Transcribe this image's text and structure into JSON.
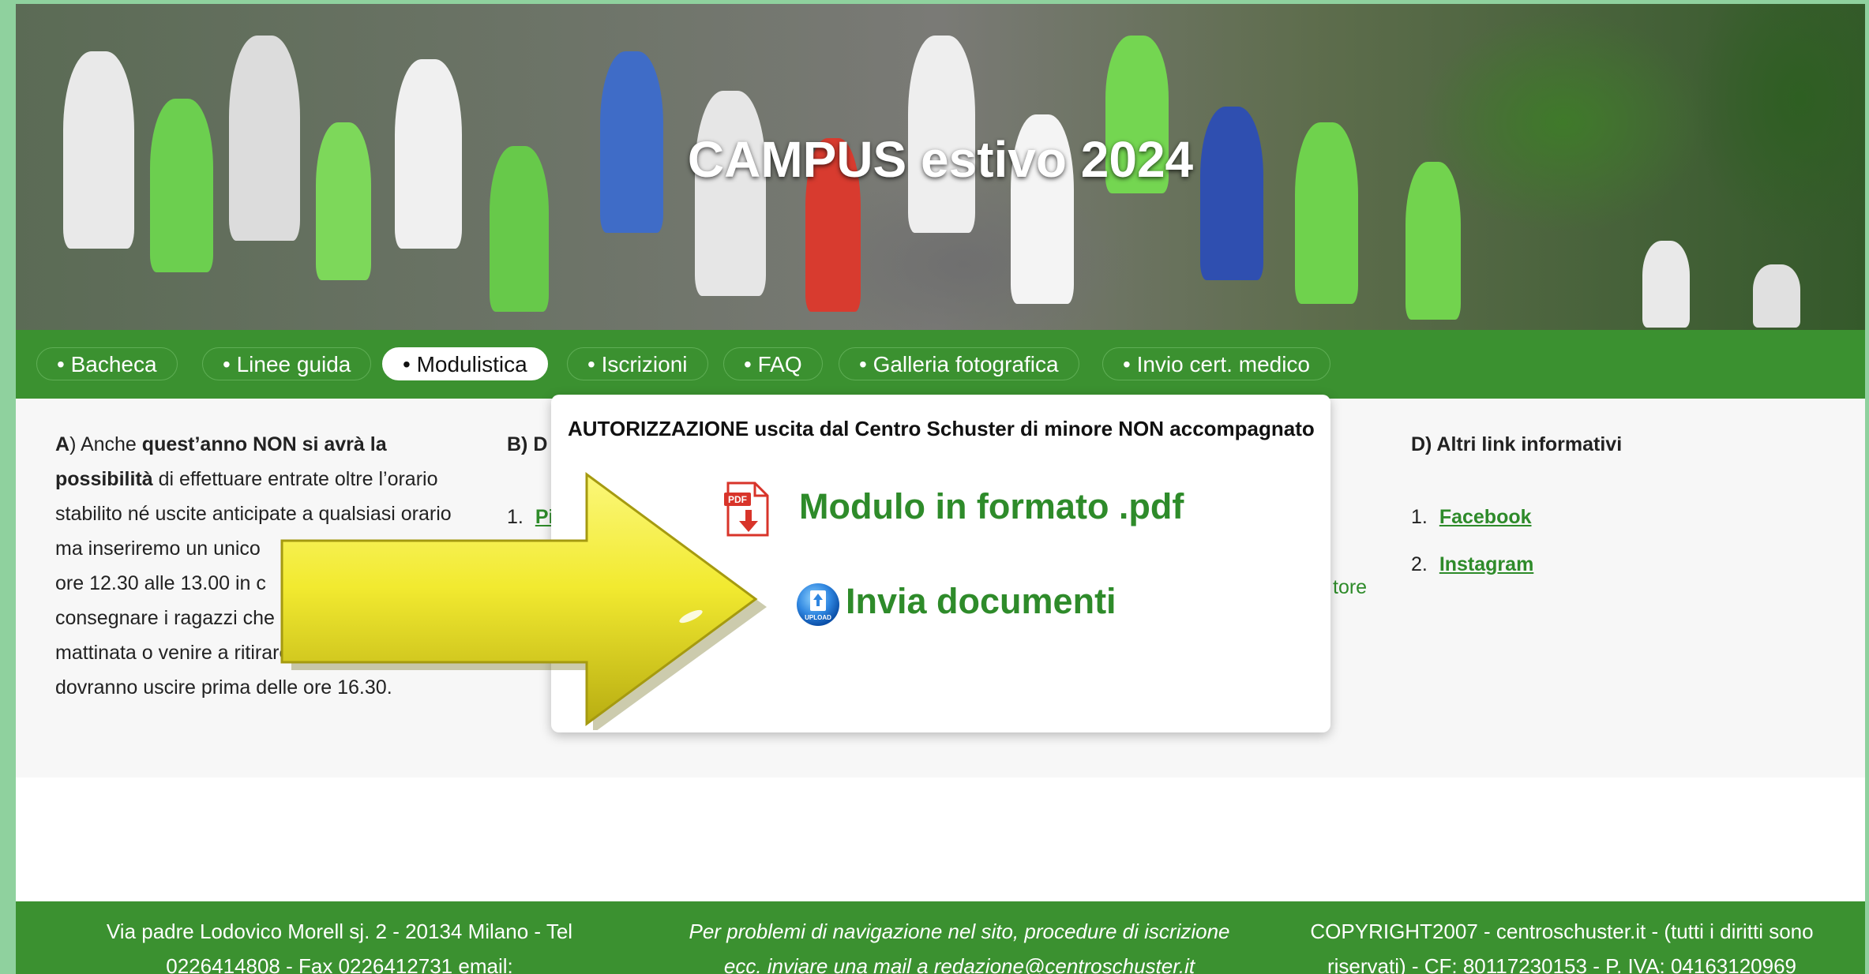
{
  "hero": {
    "title": "CAMPUS estivo 2024"
  },
  "nav": {
    "items": [
      {
        "label": "• Bacheca"
      },
      {
        "label": "• Linee guida"
      },
      {
        "label": "• Modulistica"
      },
      {
        "label": "• Iscrizioni"
      },
      {
        "label": "• FAQ"
      },
      {
        "label": "• Galleria fotografica"
      },
      {
        "label": "• Invio cert. medico"
      }
    ],
    "active_index": 2
  },
  "colA": {
    "prefix": "A",
    "t1": ") Anche ",
    "bold1": "quest’anno NON si avrà la",
    "bold2": "possibilità",
    "t2": " di effettuare entrate oltre l’orario",
    "lines": [
      "stabilito né uscite anticipate a qualsiasi orario",
      "ma inseriremo un unico",
      "ore 12.30 alle 13.00 in c",
      "consegnare i ragazzi che",
      "mattinata o venire a ritirare i ragazzi che",
      "dovranno uscire prima delle ore 16.30."
    ]
  },
  "colB": {
    "heading": "B) D",
    "num": "1.",
    "link": "Pi"
  },
  "colC": {
    "fragment": "tore"
  },
  "colD": {
    "heading": "D) Altri link informativi",
    "links": [
      {
        "num": "1.",
        "label": "Facebook"
      },
      {
        "num": "2.",
        "label": "Instagram"
      }
    ]
  },
  "popup": {
    "title": "AUTORIZZAZIONE uscita dal Centro Schuster di minore NON accompagnato",
    "pdf_link": "Modulo in formato .pdf",
    "pdf_icon_text": "PDF",
    "send_link": "Invia documenti",
    "upload_icon_text": "UPLOAD"
  },
  "footer": {
    "left1": "Via padre Lodovico Morell sj. 2 - 20134 Milano - Tel",
    "left2": "0226414808 - Fax 0226412731 email:",
    "mid1": "Per problemi di navigazione nel sito, procedure di iscrizione",
    "mid2": "ecc. inviare una mail a ",
    "mid_email": "redazione@centroschuster.it",
    "right1": "COPYRIGHT2007 - centroschuster.it - (tutti i diritti sono",
    "right2": "riservati) - CF: 80117230153 - P. IVA: 04163120969"
  },
  "colors": {
    "brand_green": "#3b9130",
    "link_green": "#2e8b2a",
    "side_green": "#8fd19e"
  }
}
